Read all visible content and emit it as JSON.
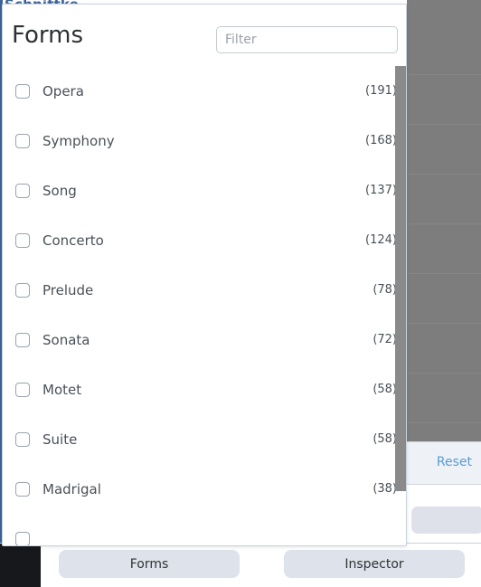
{
  "background": {
    "top_heading_partial": "Schnittke",
    "reset_label": "Reset"
  },
  "modal": {
    "title": "Forms",
    "filter": {
      "placeholder": "Filter",
      "value": ""
    },
    "items": [
      {
        "label": "Opera",
        "count": "(191)",
        "checked": false
      },
      {
        "label": "Symphony",
        "count": "(168)",
        "checked": false
      },
      {
        "label": "Song",
        "count": "(137)",
        "checked": false
      },
      {
        "label": "Concerto",
        "count": "(124)",
        "checked": false
      },
      {
        "label": "Prelude",
        "count": "(78)",
        "checked": false
      },
      {
        "label": "Sonata",
        "count": "(72)",
        "checked": false
      },
      {
        "label": "Motet",
        "count": "(58)",
        "checked": false
      },
      {
        "label": "Suite",
        "count": "(58)",
        "checked": false
      },
      {
        "label": "Madrigal",
        "count": "(38)",
        "checked": false
      },
      {
        "label": "",
        "count": "",
        "checked": false
      }
    ]
  },
  "bottom_bar": {
    "tabs": [
      {
        "label": "Forms"
      },
      {
        "label": "Inspector"
      }
    ]
  },
  "colors": {
    "accent_blue": "#5a9bd8",
    "left_strip_blue": "#3c6298",
    "scrim_gray": "#7d7d7d",
    "tab_background": "#dee2ea",
    "dark_block": "#16181c"
  }
}
